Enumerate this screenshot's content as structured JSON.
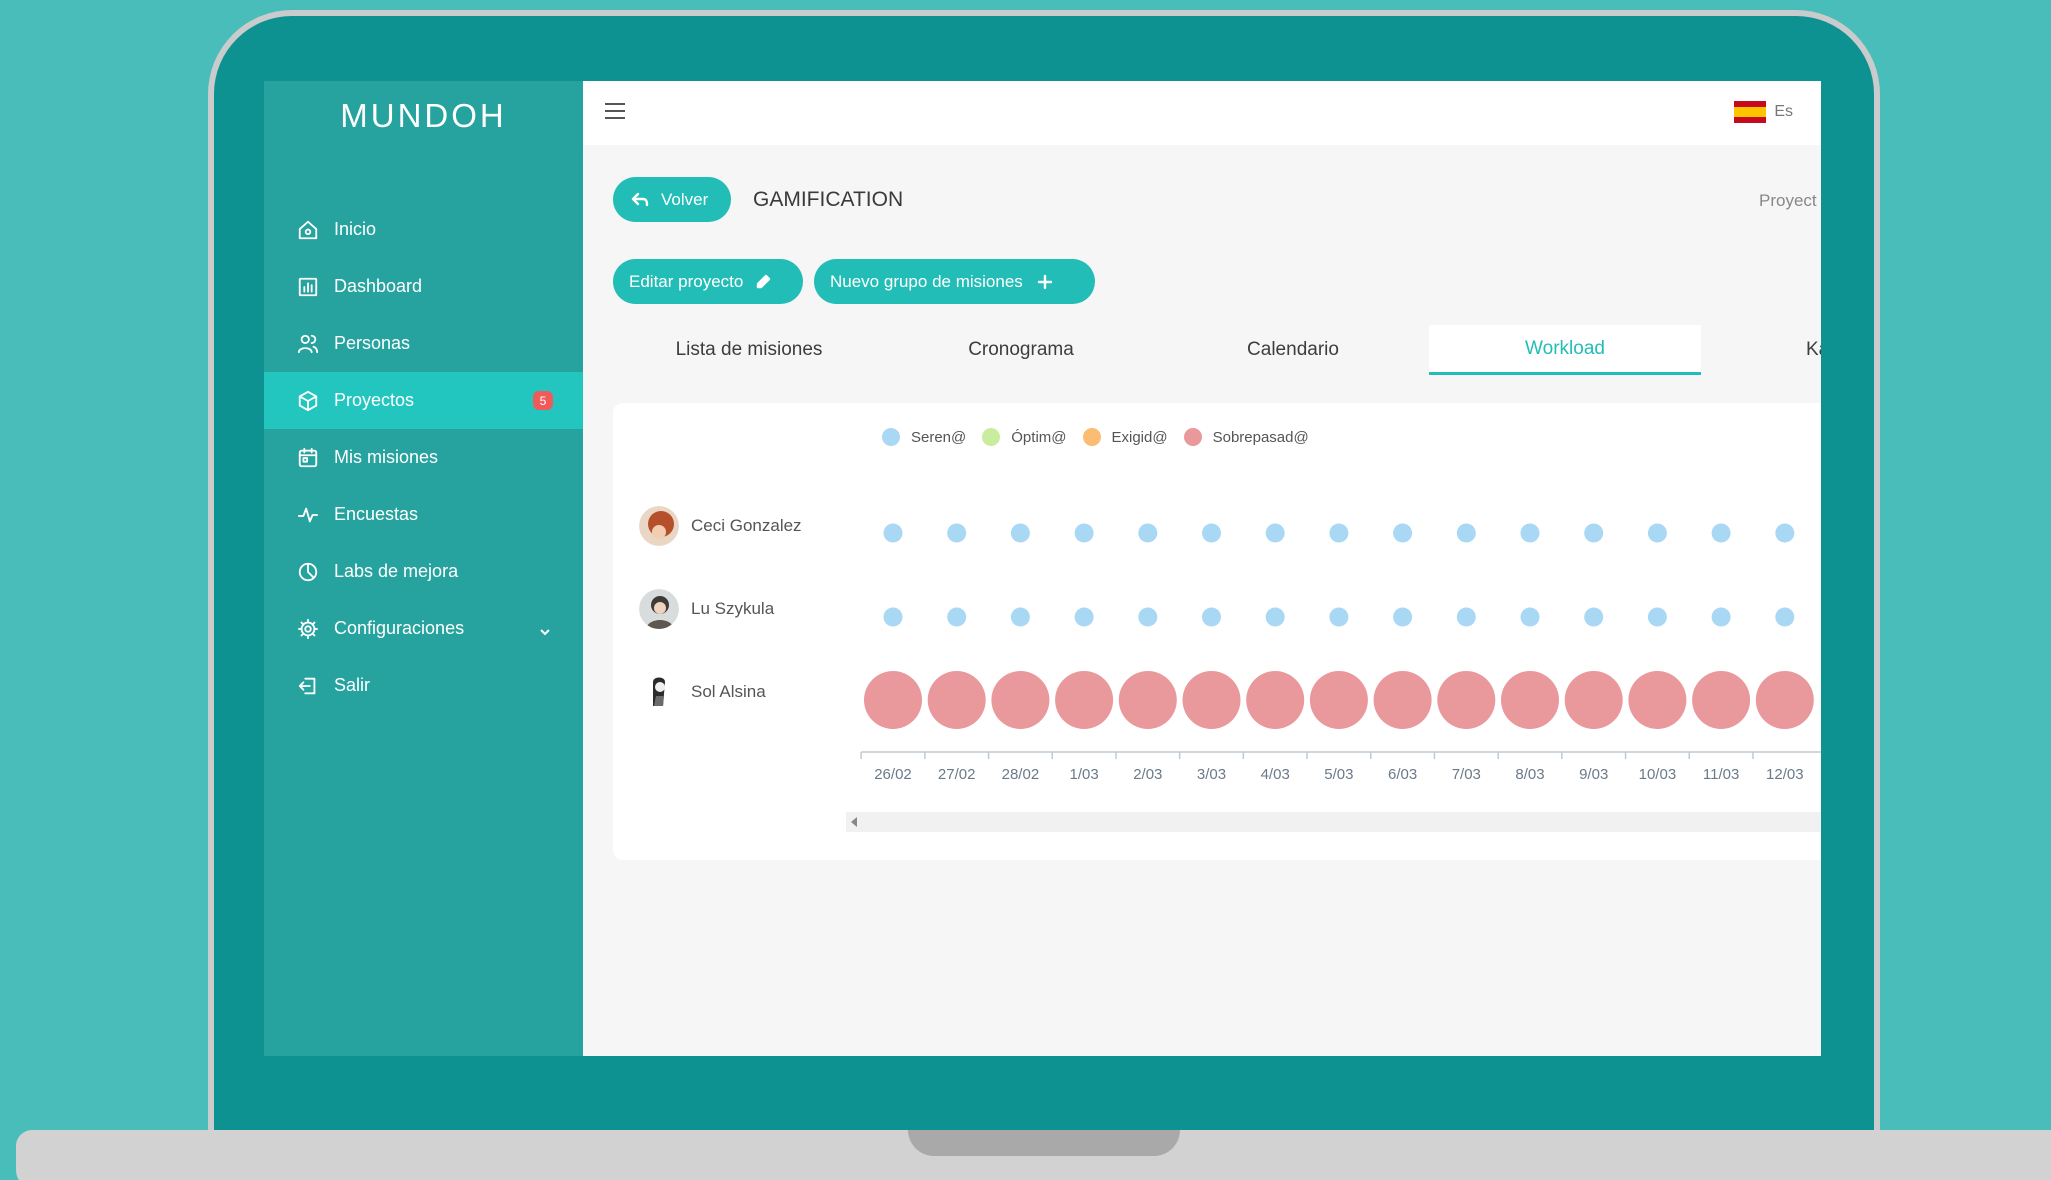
{
  "app": {
    "logo": "MUNDOH"
  },
  "sidebar": {
    "items": [
      {
        "label": "Inicio",
        "icon": "home-icon"
      },
      {
        "label": "Dashboard",
        "icon": "bar-chart-icon"
      },
      {
        "label": "Personas",
        "icon": "users-icon"
      },
      {
        "label": "Proyectos",
        "icon": "cube-icon",
        "active": true,
        "badge": "5"
      },
      {
        "label": "Mis misiones",
        "icon": "calendar-icon"
      },
      {
        "label": "Encuestas",
        "icon": "activity-icon"
      },
      {
        "label": "Labs de mejora",
        "icon": "pie-chart-icon"
      },
      {
        "label": "Configuraciones",
        "icon": "gear-icon",
        "has_submenu": true
      },
      {
        "label": "Salir",
        "icon": "logout-icon"
      }
    ]
  },
  "topbar": {
    "language": "Es"
  },
  "header": {
    "back_label": "Volver",
    "project_title": "GAMIFICATION",
    "breadcrumb": "Proyect"
  },
  "actions": {
    "edit_label": "Editar proyecto",
    "new_group_label": "Nuevo grupo de misiones"
  },
  "tabs": [
    {
      "label": "Lista de misiones"
    },
    {
      "label": "Cronograma"
    },
    {
      "label": "Calendario"
    },
    {
      "label": "Workload",
      "active": true
    },
    {
      "label": "Ka"
    }
  ],
  "colors": {
    "accent": "#23bdb7",
    "sidebar": "#27a39f",
    "seren": "#a9d8f5",
    "optim": "#c9ec9f",
    "exigid": "#fbbd73",
    "sobrepasad": "#e9999c"
  },
  "chart_data": {
    "type": "scatter",
    "legend": [
      {
        "name": "Seren@",
        "color": "#a9d8f5"
      },
      {
        "name": "Óptim@",
        "color": "#c9ec9f"
      },
      {
        "name": "Exigid@",
        "color": "#fbbd73"
      },
      {
        "name": "Sobrepasad@",
        "color": "#e9999c"
      }
    ],
    "legend_position": "top",
    "x": [
      "26/02",
      "27/02",
      "28/02",
      "1/03",
      "2/03",
      "3/03",
      "4/03",
      "5/03",
      "6/03",
      "7/03",
      "8/03",
      "9/03",
      "10/03",
      "11/03",
      "12/03"
    ],
    "rows": [
      {
        "person": "Ceci Gonzalez",
        "status": "Seren@",
        "values": [
          1,
          1,
          1,
          1,
          1,
          1,
          1,
          1,
          1,
          1,
          1,
          1,
          1,
          1,
          1
        ]
      },
      {
        "person": "Lu Szykula",
        "status": "Seren@",
        "values": [
          1,
          1,
          1,
          1,
          1,
          1,
          1,
          1,
          1,
          1,
          1,
          1,
          1,
          1,
          1
        ]
      },
      {
        "person": "Sol Alsina",
        "status": "Sobrepasad@",
        "values": [
          4,
          4,
          4,
          4,
          4,
          4,
          4,
          4,
          4,
          4,
          4,
          4,
          4,
          4,
          4
        ]
      }
    ],
    "grid": false
  }
}
